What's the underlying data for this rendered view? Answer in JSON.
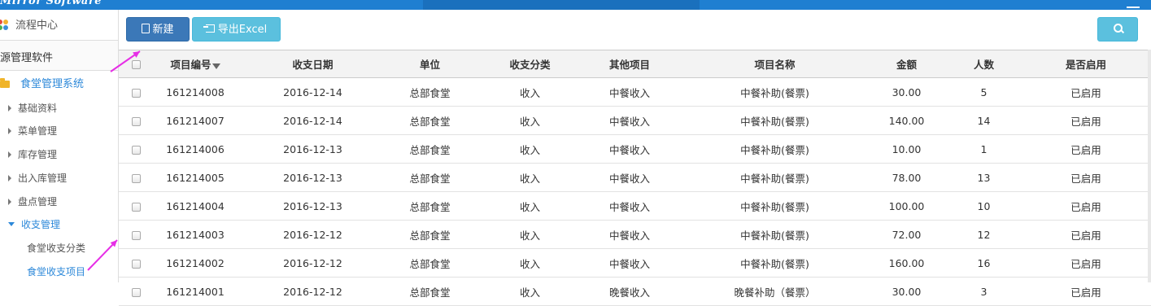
{
  "header": {
    "logo_text": "Mirror Software"
  },
  "sidebar": {
    "flow_center": "流程中心",
    "system_name": "源管理软件",
    "canteen_system": "食堂管理系统",
    "menu": [
      {
        "label": "基础资料"
      },
      {
        "label": "菜单管理"
      },
      {
        "label": "库存管理"
      },
      {
        "label": "出入库管理"
      },
      {
        "label": "盘点管理"
      },
      {
        "label": "收支管理"
      }
    ],
    "submenu": [
      {
        "label": "食堂收支分类"
      },
      {
        "label": "食堂收支项目"
      }
    ],
    "colors": {
      "active": "#2c88d9",
      "folder": "#f0b429"
    }
  },
  "toolbar": {
    "new_label": "新建",
    "export_label": "导出Excel",
    "search_icon": "search-icon",
    "colors": {
      "new": "#3b78b8",
      "export": "#5bc0de",
      "search": "#5bc0de"
    }
  },
  "table": {
    "headers": [
      "项目编号",
      "收支日期",
      "单位",
      "收支分类",
      "其他项目",
      "项目名称",
      "金额",
      "人数",
      "是否启用"
    ],
    "rows": [
      [
        "161214008",
        "2016-12-14",
        "总部食堂",
        "收入",
        "中餐收入",
        "中餐补助(餐票)",
        "30.00",
        "5",
        "已启用"
      ],
      [
        "161214007",
        "2016-12-14",
        "总部食堂",
        "收入",
        "中餐收入",
        "中餐补助(餐票)",
        "140.00",
        "14",
        "已启用"
      ],
      [
        "161214006",
        "2016-12-13",
        "总部食堂",
        "收入",
        "中餐收入",
        "中餐补助(餐票)",
        "10.00",
        "1",
        "已启用"
      ],
      [
        "161214005",
        "2016-12-13",
        "总部食堂",
        "收入",
        "中餐收入",
        "中餐补助(餐票)",
        "78.00",
        "13",
        "已启用"
      ],
      [
        "161214004",
        "2016-12-13",
        "总部食堂",
        "收入",
        "中餐收入",
        "中餐补助(餐票)",
        "100.00",
        "10",
        "已启用"
      ],
      [
        "161214003",
        "2016-12-12",
        "总部食堂",
        "收入",
        "中餐收入",
        "中餐补助(餐票)",
        "72.00",
        "12",
        "已启用"
      ],
      [
        "161214002",
        "2016-12-12",
        "总部食堂",
        "收入",
        "中餐收入",
        "中餐补助(餐票)",
        "160.00",
        "16",
        "已启用"
      ],
      [
        "161214001",
        "2016-12-12",
        "总部食堂",
        "收入",
        "晚餐收入",
        "晚餐补助（餐票）",
        "30.00",
        "3",
        "已启用"
      ]
    ]
  },
  "annotation_color": "#e62ee6"
}
